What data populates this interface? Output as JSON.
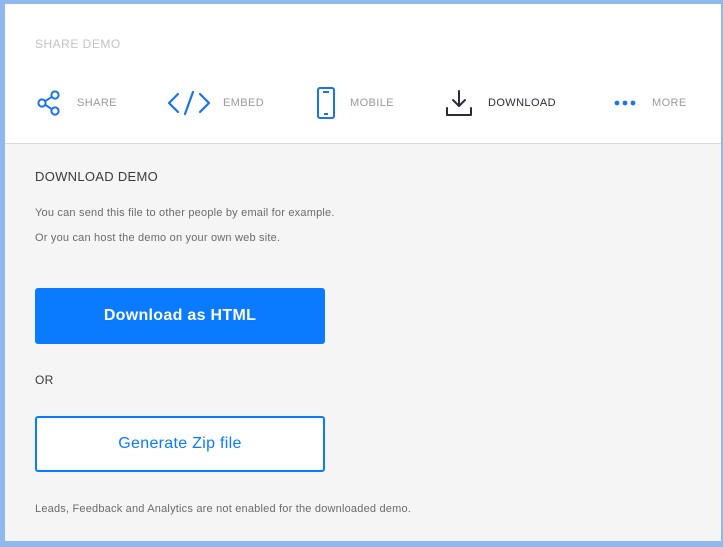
{
  "modal": {
    "title": "SHARE DEMO"
  },
  "tabs": [
    {
      "label": "SHARE",
      "icon": "share-icon",
      "active": false
    },
    {
      "label": "EMBED",
      "icon": "code-icon",
      "active": false
    },
    {
      "label": "MOBILE",
      "icon": "mobile-phone-icon",
      "active": false
    },
    {
      "label": "DOWNLOAD",
      "icon": "download-icon",
      "active": true
    },
    {
      "label": "MORE",
      "icon": "more-dots-icon",
      "active": false
    }
  ],
  "download": {
    "heading": "DOWNLOAD DEMO",
    "description_line1": "You can send this file to other people by email for example.",
    "description_line2": "Or you can host the demo on your own web site.",
    "download_html_label": "Download as HTML",
    "or_label": "OR",
    "generate_zip_label": "Generate Zip file",
    "footnote": "Leads, Feedback and Analytics are not enabled for the downloaded demo."
  },
  "colors": {
    "accent": "#0a7aff",
    "icon_blue": "#1a73e8",
    "active_icon": "#2b2b3a",
    "backdrop": "#8fb8ee"
  }
}
